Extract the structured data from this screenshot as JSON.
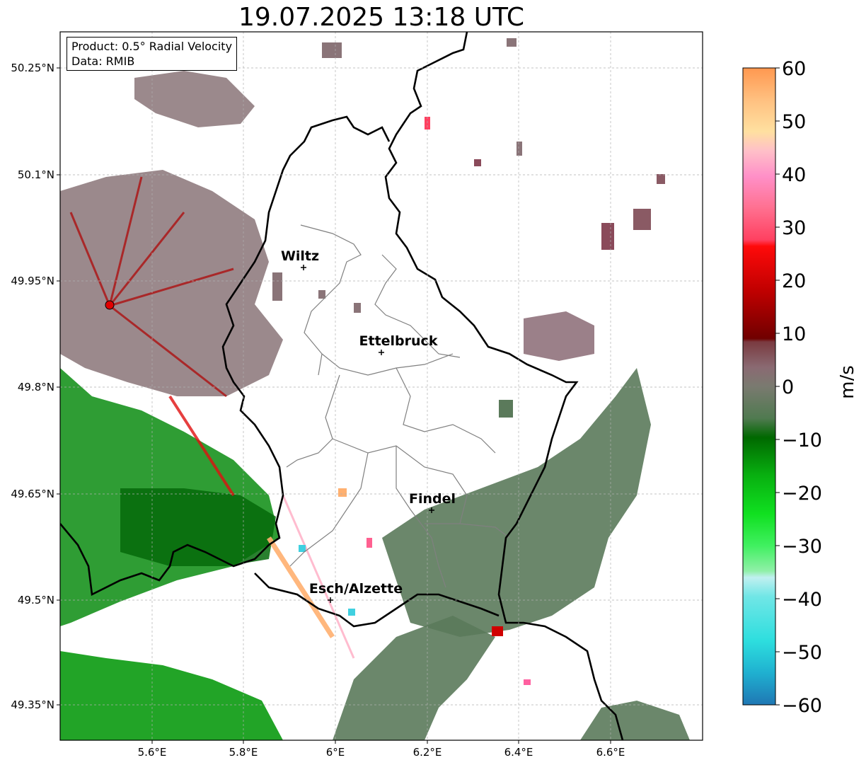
{
  "title": "19.07.2025 13:18 UTC",
  "info": {
    "product": "Product: 0.5° Radial Velocity",
    "data": "Data: RMIB"
  },
  "lat_labels": [
    "50.25°N",
    "50.1°N",
    "49.95°N",
    "49.8°N",
    "49.65°N",
    "49.5°N",
    "49.35°N"
  ],
  "lon_labels": [
    "5.6°E",
    "5.8°E",
    "6°E",
    "6.2°E",
    "6.4°E",
    "6.6°E"
  ],
  "cities": [
    {
      "name": "Wiltz"
    },
    {
      "name": "Ettelbruck"
    },
    {
      "name": "Findel"
    },
    {
      "name": "Esch/Alzette"
    }
  ],
  "colorbar": {
    "unit": "m/s",
    "min": -60,
    "max": 60,
    "ticks": [
      "60",
      "50",
      "40",
      "30",
      "20",
      "10",
      "0",
      "−10",
      "−20",
      "−30",
      "−40",
      "−50",
      "−60"
    ]
  },
  "colors": {
    "radar_site": "#e00000",
    "border": "#000000",
    "canton": "#808080"
  }
}
